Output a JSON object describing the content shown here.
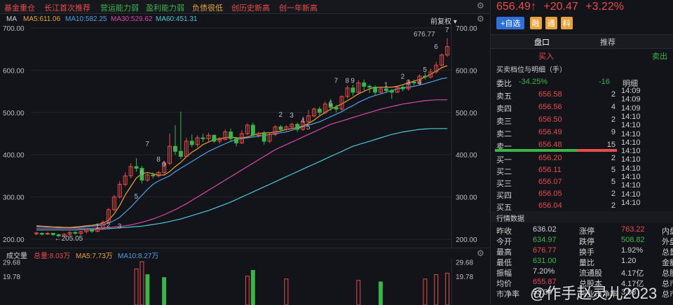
{
  "topbar": {
    "tags": [
      "基金重仓",
      "长江首次推荐",
      "营运能力弱",
      "盈利能力弱",
      "负债很低",
      "创历史新高",
      "创一年新高"
    ],
    "tag_colors": [
      "#e84c4c",
      "#e84c4c",
      "#3bb54a",
      "#3bb54a",
      "#e8a33c",
      "#e84c4c",
      "#e84c4c"
    ],
    "settings_icon": "gear-icon"
  },
  "legend": {
    "name": "MA",
    "ma5": "MA5:611.06",
    "ma10": "MA10:582.25",
    "ma30": "MA30:529.62",
    "ma60": "MA60:451.31",
    "adjust": "前复权 ▾",
    "colors": {
      "ma5": "#e8a33c",
      "ma10": "#4f9fe8",
      "ma30": "#d849a8",
      "ma60": "#4bc8d8"
    }
  },
  "chart_data": {
    "type": "candlestick",
    "ylim": [
      200,
      700
    ],
    "yticks_left": [
      "700.00",
      "600.00",
      "500.00",
      "400.00",
      "300.00",
      "200.00"
    ],
    "yticks_right": [
      "700.00",
      "600.00",
      "500.00",
      "400.00",
      "300.00",
      "200.00"
    ],
    "high_label": "676.77",
    "low_label": "←205.05",
    "candles": [
      [
        213,
        215,
        209,
        217
      ],
      [
        214,
        212,
        209,
        216
      ],
      [
        212,
        214,
        210,
        217
      ],
      [
        214,
        211,
        208,
        215
      ],
      [
        211,
        208,
        205,
        213
      ],
      [
        208,
        212,
        205,
        214
      ],
      [
        212,
        216,
        208,
        219
      ],
      [
        216,
        214,
        211,
        219
      ],
      [
        214,
        218,
        210,
        220
      ],
      [
        218,
        222,
        214,
        224
      ],
      [
        222,
        219,
        215,
        225
      ],
      [
        219,
        225,
        216,
        228
      ],
      [
        225,
        240,
        222,
        244
      ],
      [
        240,
        270,
        238,
        274
      ],
      [
        270,
        300,
        266,
        305
      ],
      [
        300,
        330,
        296,
        338
      ],
      [
        330,
        350,
        325,
        358
      ],
      [
        350,
        372,
        344,
        380
      ],
      [
        372,
        368,
        360,
        392
      ],
      [
        368,
        340,
        332,
        374
      ],
      [
        340,
        352,
        336,
        356
      ],
      [
        352,
        350,
        344,
        358
      ],
      [
        350,
        358,
        346,
        362
      ],
      [
        358,
        380,
        354,
        386
      ],
      [
        380,
        420,
        376,
        450
      ],
      [
        420,
        408,
        400,
        470
      ],
      [
        408,
        396,
        390,
        502
      ],
      [
        396,
        432,
        394,
        440
      ],
      [
        432,
        424,
        418,
        448
      ],
      [
        424,
        440,
        418,
        446
      ],
      [
        440,
        438,
        430,
        450
      ],
      [
        438,
        446,
        432,
        452
      ],
      [
        446,
        432,
        428,
        448
      ],
      [
        432,
        436,
        426,
        442
      ],
      [
        436,
        454,
        434,
        460
      ],
      [
        454,
        438,
        430,
        462
      ],
      [
        438,
        428,
        420,
        442
      ],
      [
        428,
        450,
        426,
        458
      ],
      [
        450,
        470,
        446,
        474
      ],
      [
        470,
        446,
        440,
        476
      ],
      [
        446,
        450,
        440,
        454
      ],
      [
        450,
        432,
        424,
        456
      ],
      [
        432,
        448,
        428,
        452
      ],
      [
        448,
        466,
        444,
        470
      ],
      [
        466,
        460,
        454,
        470
      ],
      [
        460,
        466,
        456,
        470
      ],
      [
        466,
        472,
        462,
        476
      ],
      [
        472,
        460,
        454,
        476
      ],
      [
        460,
        478,
        456,
        490
      ],
      [
        478,
        492,
        474,
        506
      ],
      [
        492,
        508,
        488,
        512
      ],
      [
        508,
        500,
        490,
        514
      ],
      [
        500,
        520,
        496,
        526
      ],
      [
        520,
        512,
        504,
        532
      ],
      [
        512,
        508,
        500,
        518
      ],
      [
        508,
        538,
        504,
        540
      ],
      [
        538,
        558,
        534,
        564
      ],
      [
        558,
        548,
        540,
        566
      ],
      [
        548,
        570,
        546,
        576
      ],
      [
        570,
        562,
        552,
        578
      ],
      [
        562,
        560,
        546,
        566
      ],
      [
        560,
        548,
        540,
        564
      ],
      [
        548,
        556,
        544,
        560
      ],
      [
        556,
        552,
        546,
        562
      ],
      [
        552,
        548,
        532,
        556
      ],
      [
        548,
        560,
        546,
        564
      ],
      [
        560,
        556,
        550,
        566
      ],
      [
        556,
        572,
        552,
        578
      ],
      [
        572,
        570,
        564,
        578
      ],
      [
        570,
        586,
        566,
        590
      ],
      [
        586,
        584,
        578,
        594
      ],
      [
        584,
        596,
        580,
        604
      ],
      [
        596,
        612,
        592,
        620
      ],
      [
        612,
        636,
        608,
        640
      ],
      [
        636,
        656,
        632,
        676
      ]
    ],
    "ma5": [
      232,
      231,
      230,
      229,
      229,
      228,
      228,
      229,
      230,
      232,
      233,
      235,
      238,
      245,
      260,
      280,
      305,
      325,
      345,
      355,
      358,
      355,
      352,
      352,
      360,
      372,
      382,
      395,
      406,
      414,
      424,
      430,
      436,
      438,
      440,
      442,
      440,
      440,
      442,
      446,
      450,
      452,
      452,
      454,
      456,
      460,
      462,
      464,
      468,
      474,
      482,
      492,
      500,
      508,
      514,
      520,
      528,
      536,
      544,
      550,
      556,
      560,
      560,
      560,
      560,
      562,
      566,
      570,
      574,
      578,
      584,
      590,
      598,
      606,
      611
    ],
    "ma10": [
      230,
      230,
      229,
      229,
      228,
      228,
      228,
      228,
      229,
      230,
      231,
      232,
      234,
      238,
      244,
      252,
      264,
      276,
      290,
      304,
      318,
      330,
      338,
      344,
      350,
      360,
      368,
      376,
      384,
      392,
      400,
      408,
      414,
      420,
      426,
      432,
      436,
      438,
      440,
      442,
      444,
      446,
      448,
      450,
      452,
      454,
      458,
      462,
      466,
      470,
      474,
      478,
      484,
      490,
      496,
      502,
      510,
      516,
      524,
      530,
      536,
      540,
      544,
      548,
      552,
      556,
      558,
      560,
      562,
      565,
      568,
      572,
      576,
      580,
      582
    ],
    "ma30": [
      226,
      226,
      226,
      226,
      226,
      226,
      226,
      226,
      226,
      226,
      226,
      227,
      227,
      228,
      229,
      230,
      232,
      234,
      237,
      240,
      244,
      248,
      253,
      258,
      264,
      270,
      277,
      284,
      292,
      300,
      308,
      316,
      324,
      332,
      340,
      348,
      356,
      364,
      372,
      380,
      388,
      396,
      404,
      412,
      418,
      424,
      430,
      436,
      442,
      448,
      454,
      460,
      466,
      472,
      476,
      480,
      484,
      488,
      492,
      496,
      500,
      504,
      508,
      511,
      514,
      517,
      520,
      522,
      524,
      526,
      528,
      529,
      530,
      530,
      530
    ],
    "ma60": [
      222,
      222,
      222,
      222,
      222,
      222,
      222,
      222,
      223,
      223,
      223,
      224,
      224,
      225,
      226,
      227,
      228,
      229,
      230,
      231,
      233,
      235,
      237,
      239,
      242,
      245,
      248,
      252,
      256,
      260,
      264,
      268,
      273,
      278,
      283,
      288,
      294,
      300,
      306,
      312,
      318,
      324,
      330,
      336,
      342,
      348,
      354,
      360,
      366,
      372,
      378,
      384,
      390,
      396,
      402,
      408,
      414,
      420,
      424,
      428,
      432,
      436,
      440,
      444,
      448,
      451,
      454,
      456,
      458,
      460,
      461,
      462,
      462,
      462,
      462
    ],
    "markers": [
      {
        "t": "1",
        "i": 11,
        "p": 226
      },
      {
        "t": "2",
        "i": 13,
        "p": 228
      },
      {
        "t": "3",
        "i": 15,
        "p": 226
      },
      {
        "t": "5",
        "i": 18,
        "p": 296
      },
      {
        "t": "6",
        "i": 19,
        "p": 352
      },
      {
        "t": "7",
        "i": 20,
        "p": 420
      },
      {
        "t": "8",
        "i": 22,
        "p": 384
      },
      {
        "t": "9",
        "i": 23,
        "p": 372
      },
      {
        "t": "2",
        "i": 44,
        "p": 490
      },
      {
        "t": "3",
        "i": 46,
        "p": 488
      },
      {
        "t": "4",
        "i": 48,
        "p": 476
      },
      {
        "t": "5",
        "i": 49,
        "p": 460
      },
      {
        "t": "6",
        "i": 53,
        "p": 516
      },
      {
        "t": "7",
        "i": 54,
        "p": 570
      },
      {
        "t": "8",
        "i": 56,
        "p": 570
      },
      {
        "t": "9",
        "i": 57,
        "p": 570
      },
      {
        "t": "1",
        "i": 63,
        "p": 560
      },
      {
        "t": "2",
        "i": 66,
        "p": 580
      },
      {
        "t": "3",
        "i": 67,
        "p": 566
      },
      {
        "t": "4",
        "i": 69,
        "p": 566
      },
      {
        "t": "5",
        "i": 70,
        "p": 596
      },
      {
        "t": "6",
        "i": 72,
        "p": 650
      },
      {
        "t": "7",
        "i": 74,
        "p": 690
      }
    ]
  },
  "volume": {
    "title": "成交量",
    "total": "总量:8.03万",
    "ma5": "MA5:7.73万",
    "ma10": "MA10:8.27万",
    "yticks": [
      "29.68",
      "19.78"
    ],
    "bars": [
      {
        "i": 18,
        "v": 25,
        "up": true
      },
      {
        "i": 19,
        "v": 30,
        "up": true
      },
      {
        "i": 20,
        "v": 21,
        "up": false
      },
      {
        "i": 23,
        "v": 19,
        "up": false
      },
      {
        "i": 38,
        "v": 20,
        "up": true
      },
      {
        "i": 39,
        "v": 24,
        "up": false
      },
      {
        "i": 45,
        "v": 18,
        "up": true
      },
      {
        "i": 58,
        "v": 17,
        "up": true
      },
      {
        "i": 62,
        "v": 16,
        "up": false
      },
      {
        "i": 70,
        "v": 18,
        "up": true
      },
      {
        "i": 72,
        "v": 21,
        "up": true
      },
      {
        "i": 74,
        "v": 22,
        "up": true
      }
    ]
  },
  "quote": {
    "price": "656.49↑",
    "change": "+20.47",
    "pct": "+3.22%"
  },
  "actions": {
    "add": "+自选",
    "b1": "融",
    "b2": "通",
    "b3": "料"
  },
  "tabs": {
    "t1": "盘口",
    "t2": "推荐"
  },
  "trade": {
    "buy": "买入",
    "sell": "卖出"
  },
  "book": {
    "title": "买卖档位与明细（手）",
    "ratio_label": "委比",
    "ratio": "-34.25%",
    "diff": "-16",
    "detail_label": "明细",
    "asks": [
      {
        "name": "卖五",
        "price": "656.58",
        "vol": "2"
      },
      {
        "name": "卖四",
        "price": "656.56",
        "vol": "4"
      },
      {
        "name": "卖三",
        "price": "656.50",
        "vol": "2"
      },
      {
        "name": "卖二",
        "price": "656.49",
        "vol": "9"
      },
      {
        "name": "卖一",
        "price": "656.48",
        "vol": "15"
      }
    ],
    "bids": [
      {
        "name": "买一",
        "price": "656.20",
        "vol": "2"
      },
      {
        "name": "买二",
        "price": "656.11",
        "vol": "5"
      },
      {
        "name": "买三",
        "price": "656.07",
        "vol": "5"
      },
      {
        "name": "买四",
        "price": "656.05",
        "vol": "2"
      },
      {
        "name": "买五",
        "price": "656.04",
        "vol": "2"
      }
    ],
    "times": [
      "14:09",
      "14:09",
      "14:09",
      "14:10",
      "14:10",
      "14:10",
      "14:10",
      "14:10",
      "14:10",
      "14:10",
      "14:10",
      "14:10",
      "14:10",
      "14:10"
    ]
  },
  "stats": {
    "title": "行情数据",
    "rows": [
      {
        "a": "昨收",
        "av": "636.02",
        "ac": "#d0d0d0",
        "b": "涨停",
        "bv": "763.22",
        "bc": "#e84c4c",
        "c": "内盘"
      },
      {
        "a": "今开",
        "av": "634.97",
        "ac": "#3bb54a",
        "b": "跌停",
        "bv": "508.82",
        "bc": "#3bb54a",
        "c": "外盘"
      },
      {
        "a": "最高",
        "av": "676.77",
        "ac": "#e84c4c",
        "b": "换手",
        "bv": "1.92%",
        "bc": "#d0d0d0",
        "c": "总量"
      },
      {
        "a": "最低",
        "av": "631.00",
        "ac": "#3bb54a",
        "b": "量比",
        "bv": "1.20",
        "bc": "#d0d0d0",
        "c": "金额"
      },
      {
        "a": "振幅",
        "av": "7.20%",
        "ac": "#d0d0d0",
        "b": "流通股",
        "bv": "4.17亿",
        "bc": "#d0d0d0",
        "c": "总股"
      },
      {
        "a": "均价",
        "av": "655.87",
        "ac": "#e84c4c",
        "b": "总股本",
        "bv": "4.17亿",
        "bc": "#d0d0d0",
        "c": "总市"
      },
      {
        "a": "市净率",
        "av": "53.34",
        "ac": "#d0d0d0",
        "b": "行业市净率",
        "bv": "3.08",
        "bc": "#d0d0d0",
        "c": "总市"
      }
    ]
  },
  "watermark": "@作手赵灵儿2023"
}
